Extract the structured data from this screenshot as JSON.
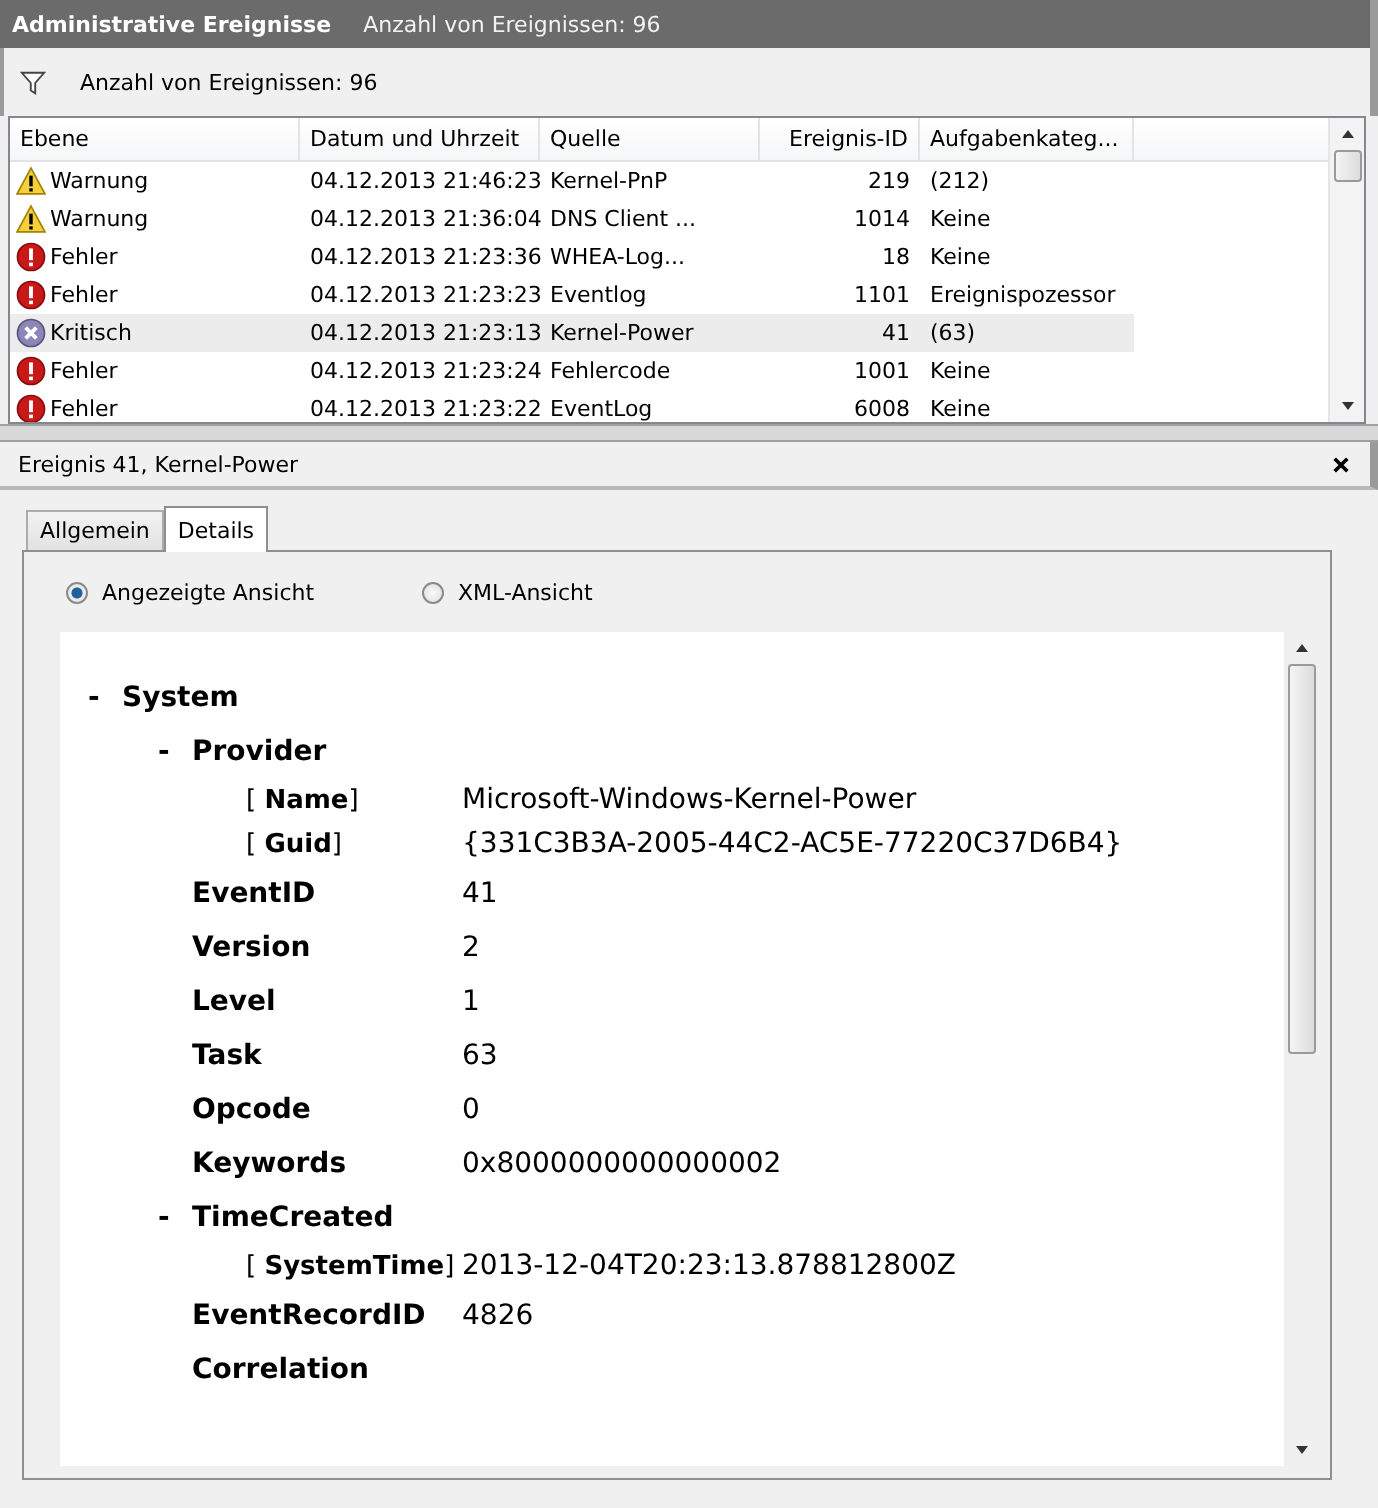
{
  "header": {
    "title": "Administrative Ereignisse",
    "count": "Anzahl von Ereignissen: 96"
  },
  "filter_bar": {
    "text": "Anzahl von Ereignissen: 96"
  },
  "table": {
    "columns": [
      "Ebene",
      "Datum und Uhrzeit",
      "Quelle",
      "Ereignis-ID",
      "Aufgabenkateg..."
    ],
    "rows": [
      {
        "kind": "warning",
        "level": "Warnung",
        "date": "04.12.2013 21:46:23",
        "source": "Kernel-PnP",
        "id": "219",
        "category": "(212)",
        "selected": false
      },
      {
        "kind": "warning",
        "level": "Warnung",
        "date": "04.12.2013 21:36:04",
        "source": "DNS Client ...",
        "id": "1014",
        "category": "Keine",
        "selected": false
      },
      {
        "kind": "error",
        "level": "Fehler",
        "date": "04.12.2013 21:23:36",
        "source": "WHEA-Log...",
        "id": "18",
        "category": "Keine",
        "selected": false
      },
      {
        "kind": "error",
        "level": "Fehler",
        "date": "04.12.2013 21:23:23",
        "source": "Eventlog",
        "id": "1101",
        "category": "Ereignispozessor",
        "selected": false
      },
      {
        "kind": "critical",
        "level": "Kritisch",
        "date": "04.12.2013 21:23:13",
        "source": "Kernel-Power",
        "id": "41",
        "category": "(63)",
        "selected": true
      },
      {
        "kind": "error",
        "level": "Fehler",
        "date": "04.12.2013 21:23:24",
        "source": "Fehlercode",
        "id": "1001",
        "category": "Keine",
        "selected": false
      },
      {
        "kind": "error",
        "level": "Fehler",
        "date": "04.12.2013 21:23:22",
        "source": "EventLog",
        "id": "6008",
        "category": "Keine",
        "selected": false
      }
    ]
  },
  "detail": {
    "title": "Ereignis 41, Kernel-Power",
    "tabs": [
      {
        "label": "Allgemein",
        "selected": false
      },
      {
        "label": "Details",
        "selected": true
      }
    ],
    "views": [
      {
        "label": "Angezeigte Ansicht",
        "selected": true
      },
      {
        "label": "XML-Ansicht",
        "selected": false
      }
    ],
    "tree": [
      {
        "kind": "group",
        "toggle": "-",
        "label": "System",
        "children": [
          {
            "kind": "group",
            "toggle": "-",
            "label": "Provider",
            "children": [
              {
                "kind": "attribute",
                "label": "[ **Name**]",
                "value": "Microsoft-Windows-Kernel-Power"
              },
              {
                "kind": "attribute",
                "label": "[ **Guid**]",
                "value": "{331C3B3A-2005-44C2-AC5E-77220C37D6B4}"
              }
            ]
          },
          {
            "kind": "field",
            "label": "EventID",
            "value": "41"
          },
          {
            "kind": "field",
            "label": "Version",
            "value": "2"
          },
          {
            "kind": "field",
            "label": "Level",
            "value": "1"
          },
          {
            "kind": "field",
            "label": "Task",
            "value": "63"
          },
          {
            "kind": "field",
            "label": "Opcode",
            "value": "0"
          },
          {
            "kind": "field",
            "label": "Keywords",
            "value": "0x8000000000000002"
          },
          {
            "kind": "group",
            "toggle": "-",
            "label": "TimeCreated",
            "children": [
              {
                "kind": "attribute",
                "label": "[ **SystemTime**]",
                "value": "2013-12-04T20:23:13.878812800Z"
              }
            ]
          },
          {
            "kind": "field",
            "label": "EventRecordID",
            "value": "4826"
          },
          {
            "kind": "field",
            "label": "Correlation"
          }
        ]
      }
    ]
  }
}
